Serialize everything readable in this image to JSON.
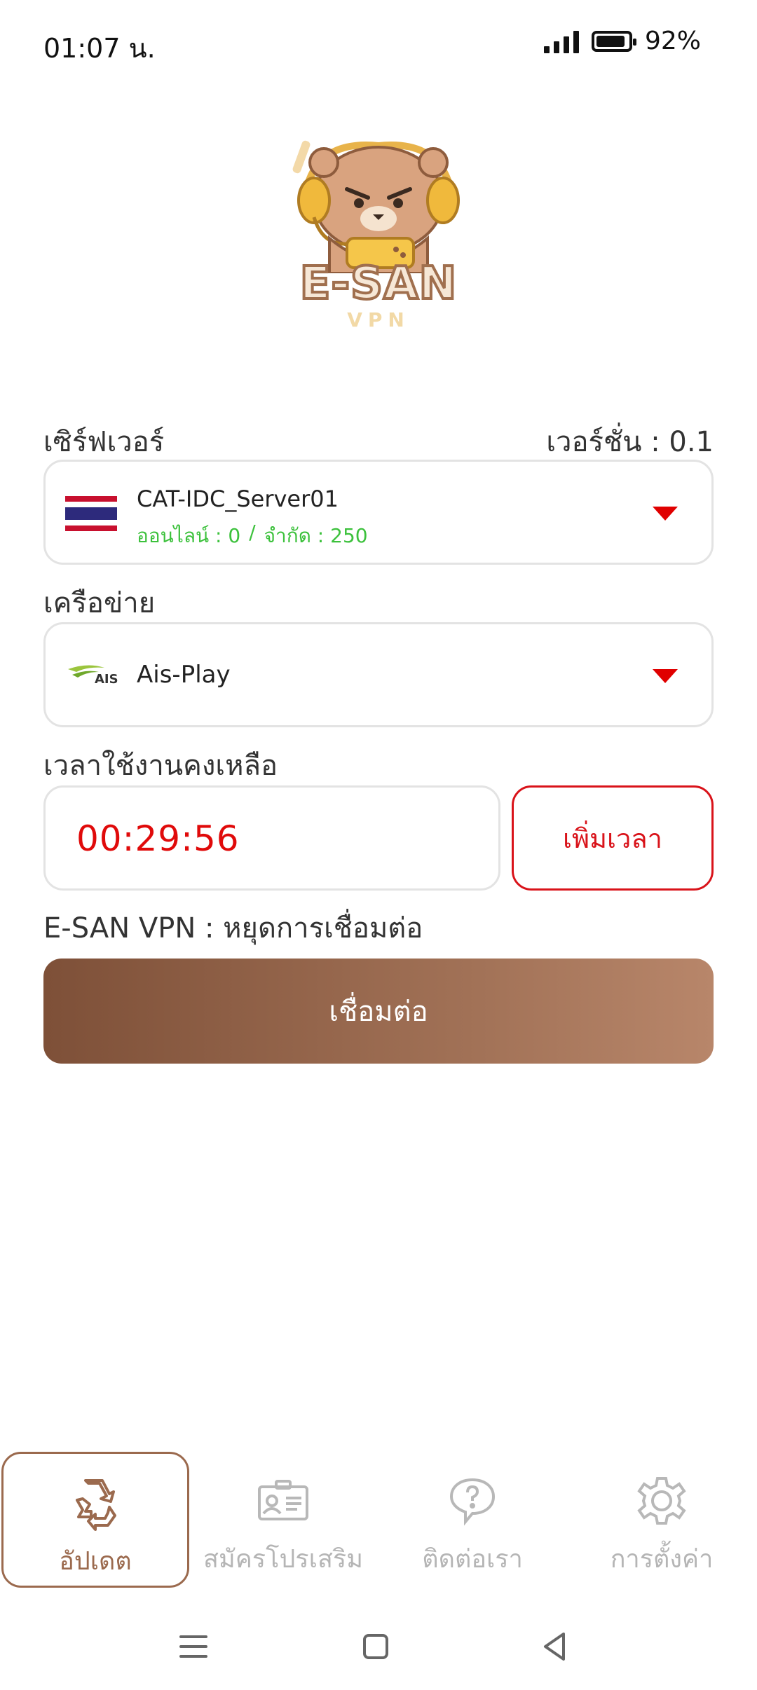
{
  "status_bar": {
    "time": "01:07 น.",
    "battery_percent": "92%",
    "battery_level": 0.92
  },
  "logo": {
    "title": "E-SAN",
    "subtitle": "VPN"
  },
  "server": {
    "label": "เซิร์ฟเวอร์",
    "version_label": "เวอร์ชั่น : 0.1",
    "name": "CAT-IDC_Server01",
    "online": "ออนไลน์ : 0",
    "separator": "/",
    "limit": "จำกัด : 250",
    "flag_icon": "thailand-flag"
  },
  "network": {
    "label": "เครือข่าย",
    "name": "Ais-Play",
    "logo_text": "AIS"
  },
  "time": {
    "label": "เวลาใช้งานคงเหลือ",
    "remaining": "00:29:56",
    "add_button": "เพิ่มเวลา"
  },
  "connection": {
    "status": "E-SAN VPN : หยุดการเชื่อมต่อ",
    "button": "เชื่อมต่อ"
  },
  "bottom_nav": [
    {
      "label": "อัปเดต",
      "icon": "recycle-icon",
      "active": true
    },
    {
      "label": "สมัครโปรเสริม",
      "icon": "id-card-icon",
      "active": false
    },
    {
      "label": "ติดต่อเรา",
      "icon": "help-chat-icon",
      "active": false
    },
    {
      "label": "การตั้งค่า",
      "icon": "gear-icon",
      "active": false
    }
  ],
  "colors": {
    "accent_brown": "#9b6a4e",
    "alert_red": "#e00a0a",
    "online_green": "#3cc13c"
  }
}
